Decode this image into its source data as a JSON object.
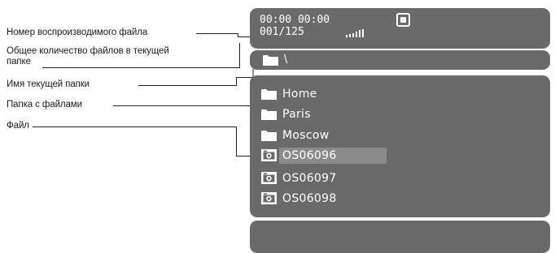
{
  "callouts": {
    "file_number": "Номер воспроизводимого файла",
    "file_count_line1": "Общее количество файлов в текущей",
    "file_count_line2": "папке",
    "current_folder": "Имя текущей папки",
    "folder_with_files": "Папка с файлами",
    "file": "Файл"
  },
  "status": {
    "time": "00:00  00:00",
    "file_counter": "001/125",
    "signal_icon": "signal-bars-icon",
    "stop_icon": "stop-icon"
  },
  "folder_bar": {
    "icon": "folder-icon",
    "path": "\\"
  },
  "list": {
    "items": [
      {
        "type": "folder",
        "icon": "folder-icon",
        "label": "Home"
      },
      {
        "type": "folder",
        "icon": "folder-icon",
        "label": "Paris"
      },
      {
        "type": "folder",
        "icon": "folder-icon",
        "label": "Moscow"
      },
      {
        "type": "file",
        "icon": "photo-icon",
        "label": "OS06096",
        "selected": true
      },
      {
        "type": "file",
        "icon": "photo-icon",
        "label": "OS06097"
      },
      {
        "type": "file",
        "icon": "photo-icon",
        "label": "OS06098"
      }
    ]
  },
  "colors": {
    "panel": "#6a6a6a",
    "highlight": "#8a8a8a",
    "text": "#ffffff",
    "leader": "#222222"
  }
}
